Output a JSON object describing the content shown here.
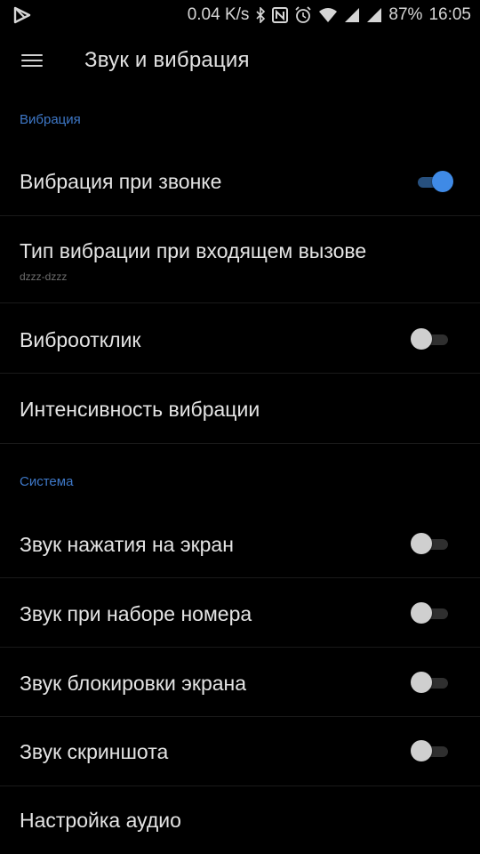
{
  "status_bar": {
    "network_speed": "0.04 K/s",
    "battery": "87%",
    "time": "16:05",
    "icons": [
      "play-store-icon",
      "bluetooth-icon",
      "nfc-icon",
      "alarm-icon",
      "wifi-icon",
      "signal-icon",
      "signal-icon-2",
      "battery-icon"
    ]
  },
  "toolbar": {
    "menu_icon": "hamburger-menu-icon",
    "title": "Звук и вибрация"
  },
  "sections": {
    "vibration": {
      "header": "Вибрация",
      "items": [
        {
          "title": "Вибрация при звонке",
          "toggle": true
        },
        {
          "title": "Тип вибрации при входящем вызове",
          "subtitle": "dzzz-dzzz"
        },
        {
          "title": "Виброотклик",
          "toggle": false
        },
        {
          "title": "Интенсивность вибрации"
        }
      ]
    },
    "system": {
      "header": "Система",
      "items": [
        {
          "title": "Звук нажатия на экран",
          "toggle": false
        },
        {
          "title": "Звук при наборе номера",
          "toggle": false
        },
        {
          "title": "Звук блокировки экрана",
          "toggle": false
        },
        {
          "title": "Звук скриншота",
          "toggle": false
        },
        {
          "title": "Настройка аудио"
        }
      ]
    }
  },
  "colors": {
    "background": "#000000",
    "accent": "#3f8ae6",
    "section_header": "#3e78c8",
    "text_primary": "#e4e4e4",
    "text_secondary": "#6e6e6e"
  }
}
